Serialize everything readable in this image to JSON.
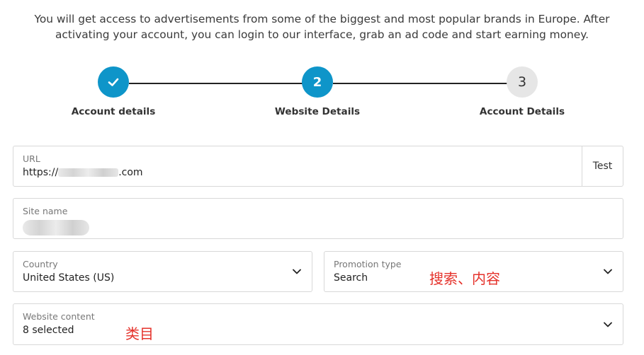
{
  "intro_text": "You will get access to advertisements from some of the biggest and most popular brands in Europe. After activating your account, you can login to our interface, grab an ad code and start earning money.",
  "steps": [
    {
      "label": "Account details",
      "marker": "",
      "state": "done"
    },
    {
      "label": "Website Details",
      "marker": "2",
      "state": "active"
    },
    {
      "label": "Account Details",
      "marker": "3",
      "state": "pending"
    }
  ],
  "url_field": {
    "label": "URL",
    "value_prefix": "https://",
    "value_suffix": ".com",
    "test_button": "Test"
  },
  "site_name_field": {
    "label": "Site name"
  },
  "country_field": {
    "label": "Country",
    "value": "United States (US)"
  },
  "promotion_field": {
    "label": "Promotion type",
    "value": "Search",
    "annotation": "搜索、内容"
  },
  "content_field": {
    "label": "Website content",
    "value": "8 selected",
    "annotation": "类目"
  },
  "colors": {
    "accent": "#0e95c9",
    "annotation": "#e5322b"
  }
}
